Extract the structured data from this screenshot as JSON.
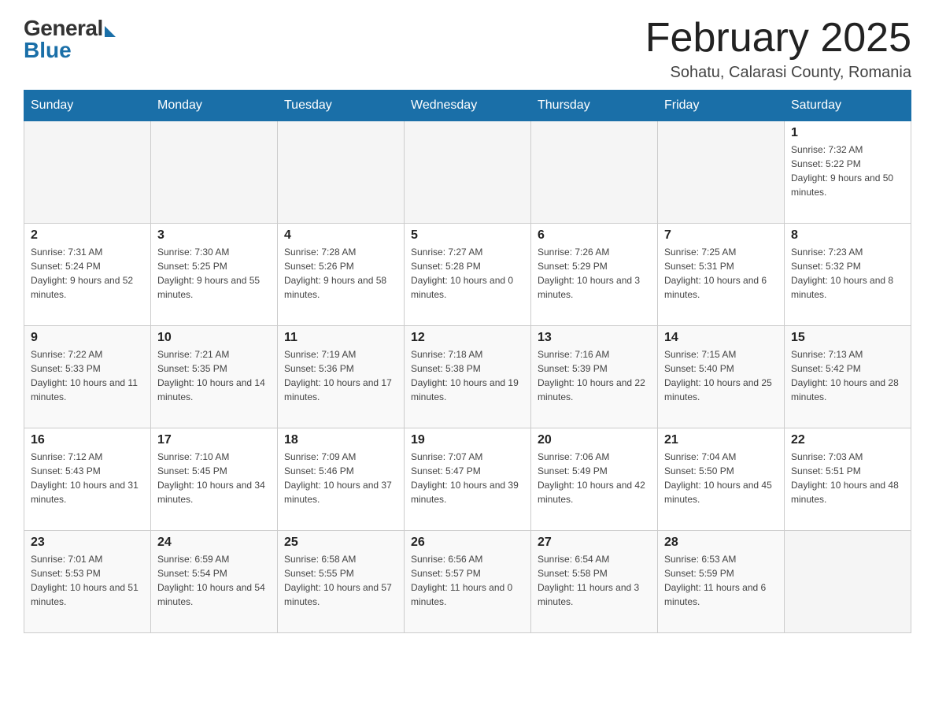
{
  "header": {
    "logo_general": "General",
    "logo_blue": "Blue",
    "month_title": "February 2025",
    "location": "Sohatu, Calarasi County, Romania"
  },
  "days_of_week": [
    "Sunday",
    "Monday",
    "Tuesday",
    "Wednesday",
    "Thursday",
    "Friday",
    "Saturday"
  ],
  "weeks": [
    [
      {
        "day": "",
        "info": ""
      },
      {
        "day": "",
        "info": ""
      },
      {
        "day": "",
        "info": ""
      },
      {
        "day": "",
        "info": ""
      },
      {
        "day": "",
        "info": ""
      },
      {
        "day": "",
        "info": ""
      },
      {
        "day": "1",
        "info": "Sunrise: 7:32 AM\nSunset: 5:22 PM\nDaylight: 9 hours and 50 minutes."
      }
    ],
    [
      {
        "day": "2",
        "info": "Sunrise: 7:31 AM\nSunset: 5:24 PM\nDaylight: 9 hours and 52 minutes."
      },
      {
        "day": "3",
        "info": "Sunrise: 7:30 AM\nSunset: 5:25 PM\nDaylight: 9 hours and 55 minutes."
      },
      {
        "day": "4",
        "info": "Sunrise: 7:28 AM\nSunset: 5:26 PM\nDaylight: 9 hours and 58 minutes."
      },
      {
        "day": "5",
        "info": "Sunrise: 7:27 AM\nSunset: 5:28 PM\nDaylight: 10 hours and 0 minutes."
      },
      {
        "day": "6",
        "info": "Sunrise: 7:26 AM\nSunset: 5:29 PM\nDaylight: 10 hours and 3 minutes."
      },
      {
        "day": "7",
        "info": "Sunrise: 7:25 AM\nSunset: 5:31 PM\nDaylight: 10 hours and 6 minutes."
      },
      {
        "day": "8",
        "info": "Sunrise: 7:23 AM\nSunset: 5:32 PM\nDaylight: 10 hours and 8 minutes."
      }
    ],
    [
      {
        "day": "9",
        "info": "Sunrise: 7:22 AM\nSunset: 5:33 PM\nDaylight: 10 hours and 11 minutes."
      },
      {
        "day": "10",
        "info": "Sunrise: 7:21 AM\nSunset: 5:35 PM\nDaylight: 10 hours and 14 minutes."
      },
      {
        "day": "11",
        "info": "Sunrise: 7:19 AM\nSunset: 5:36 PM\nDaylight: 10 hours and 17 minutes."
      },
      {
        "day": "12",
        "info": "Sunrise: 7:18 AM\nSunset: 5:38 PM\nDaylight: 10 hours and 19 minutes."
      },
      {
        "day": "13",
        "info": "Sunrise: 7:16 AM\nSunset: 5:39 PM\nDaylight: 10 hours and 22 minutes."
      },
      {
        "day": "14",
        "info": "Sunrise: 7:15 AM\nSunset: 5:40 PM\nDaylight: 10 hours and 25 minutes."
      },
      {
        "day": "15",
        "info": "Sunrise: 7:13 AM\nSunset: 5:42 PM\nDaylight: 10 hours and 28 minutes."
      }
    ],
    [
      {
        "day": "16",
        "info": "Sunrise: 7:12 AM\nSunset: 5:43 PM\nDaylight: 10 hours and 31 minutes."
      },
      {
        "day": "17",
        "info": "Sunrise: 7:10 AM\nSunset: 5:45 PM\nDaylight: 10 hours and 34 minutes."
      },
      {
        "day": "18",
        "info": "Sunrise: 7:09 AM\nSunset: 5:46 PM\nDaylight: 10 hours and 37 minutes."
      },
      {
        "day": "19",
        "info": "Sunrise: 7:07 AM\nSunset: 5:47 PM\nDaylight: 10 hours and 39 minutes."
      },
      {
        "day": "20",
        "info": "Sunrise: 7:06 AM\nSunset: 5:49 PM\nDaylight: 10 hours and 42 minutes."
      },
      {
        "day": "21",
        "info": "Sunrise: 7:04 AM\nSunset: 5:50 PM\nDaylight: 10 hours and 45 minutes."
      },
      {
        "day": "22",
        "info": "Sunrise: 7:03 AM\nSunset: 5:51 PM\nDaylight: 10 hours and 48 minutes."
      }
    ],
    [
      {
        "day": "23",
        "info": "Sunrise: 7:01 AM\nSunset: 5:53 PM\nDaylight: 10 hours and 51 minutes."
      },
      {
        "day": "24",
        "info": "Sunrise: 6:59 AM\nSunset: 5:54 PM\nDaylight: 10 hours and 54 minutes."
      },
      {
        "day": "25",
        "info": "Sunrise: 6:58 AM\nSunset: 5:55 PM\nDaylight: 10 hours and 57 minutes."
      },
      {
        "day": "26",
        "info": "Sunrise: 6:56 AM\nSunset: 5:57 PM\nDaylight: 11 hours and 0 minutes."
      },
      {
        "day": "27",
        "info": "Sunrise: 6:54 AM\nSunset: 5:58 PM\nDaylight: 11 hours and 3 minutes."
      },
      {
        "day": "28",
        "info": "Sunrise: 6:53 AM\nSunset: 5:59 PM\nDaylight: 11 hours and 6 minutes."
      },
      {
        "day": "",
        "info": ""
      }
    ]
  ]
}
